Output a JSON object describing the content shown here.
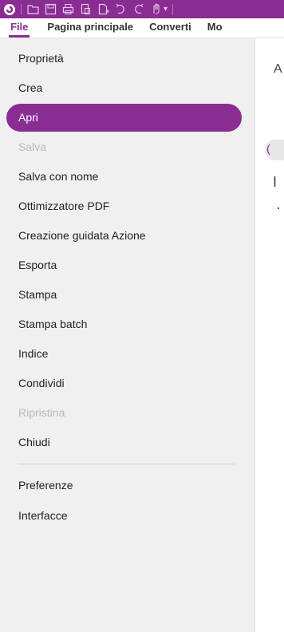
{
  "app": {
    "brand_color": "#8a2d92"
  },
  "toolbar": {
    "icons": [
      "app-logo-icon",
      "open-folder-icon",
      "save-icon",
      "print-icon",
      "create-pdf-icon",
      "new-page-icon",
      "undo-icon",
      "redo-icon",
      "hand-tool-icon"
    ],
    "chevron": "▾"
  },
  "ribbon": {
    "tabs": [
      {
        "label": "File",
        "active": true
      },
      {
        "label": "Pagina principale",
        "active": false
      },
      {
        "label": "Converti",
        "active": false
      },
      {
        "label": "Mo",
        "active": false
      }
    ]
  },
  "file_menu": {
    "items": [
      {
        "label": "Proprietà",
        "state": "normal"
      },
      {
        "label": "Crea",
        "state": "normal"
      },
      {
        "label": "Apri",
        "state": "selected"
      },
      {
        "label": "Salva",
        "state": "disabled"
      },
      {
        "label": "Salva con nome",
        "state": "normal"
      },
      {
        "label": "Ottimizzatore PDF",
        "state": "normal"
      },
      {
        "label": "Creazione guidata Azione",
        "state": "normal"
      },
      {
        "label": "Esporta",
        "state": "normal"
      },
      {
        "label": "Stampa",
        "state": "normal"
      },
      {
        "label": "Stampa batch",
        "state": "normal"
      },
      {
        "label": "Indice",
        "state": "normal"
      },
      {
        "label": "Condividi",
        "state": "normal"
      },
      {
        "label": "Ripristina",
        "state": "disabled"
      },
      {
        "label": "Chiudi",
        "state": "normal"
      },
      {
        "label": "Preferenze",
        "state": "normal"
      },
      {
        "label": "Interfacce",
        "state": "normal"
      }
    ]
  },
  "content_panel": {
    "fragment_a": "A",
    "fragment_b": "I",
    "fragment_c": "·",
    "pill_text": "("
  }
}
